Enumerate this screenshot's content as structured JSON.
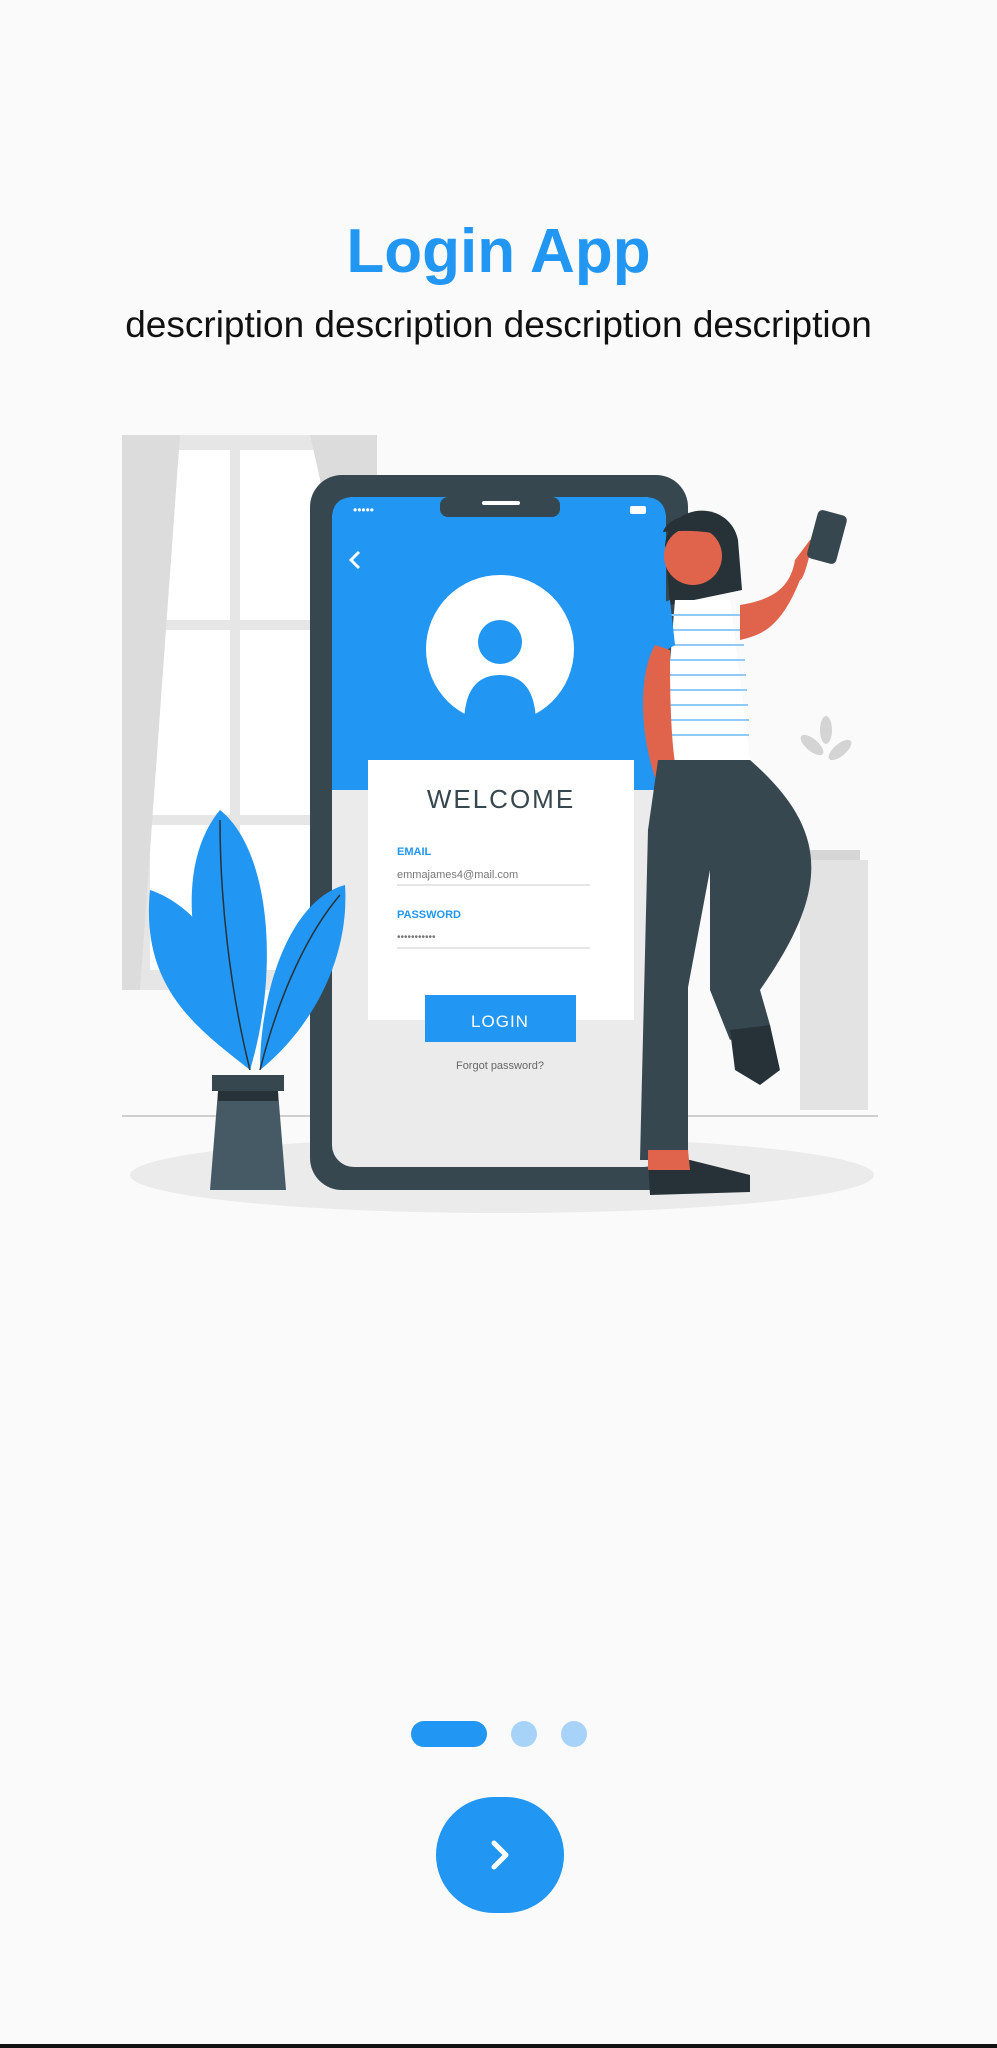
{
  "header": {
    "title": "Login App",
    "description": "description description description description"
  },
  "illustration": {
    "welcome": "WELCOME",
    "email_label": "EMAIL",
    "email_value": "emmajames4@mail.com",
    "password_label": "PASSWORD",
    "password_value": "•••••••••••",
    "login_label": "LOGIN",
    "forgot_label": "Forgot password?"
  },
  "pager": {
    "page_count": 3,
    "active_index": 0
  },
  "next_button": {
    "icon": "chevron-right-icon"
  },
  "colors": {
    "accent": "#2196f3",
    "accent_light": "#a6d3f7",
    "background": "#fafafa"
  }
}
